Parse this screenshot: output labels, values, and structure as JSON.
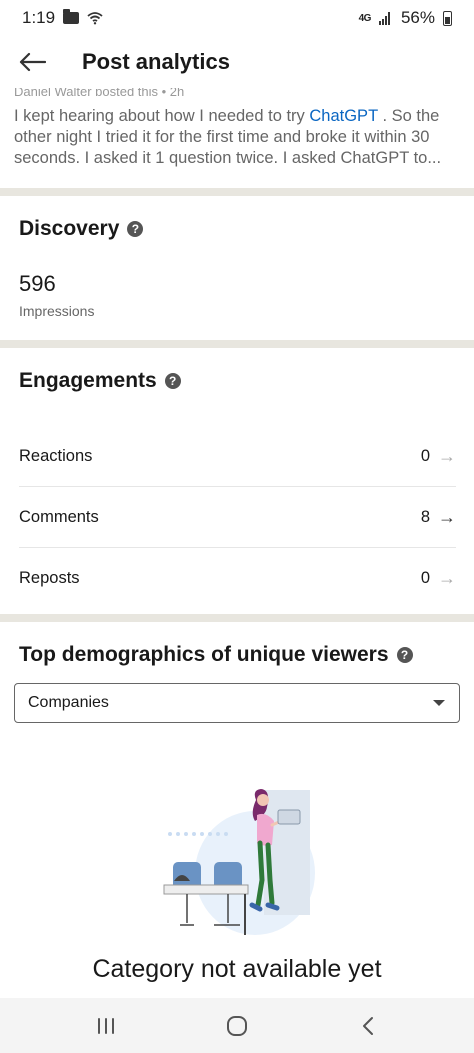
{
  "status_bar": {
    "time": "1:19",
    "network": "4G",
    "battery": "56%"
  },
  "header": {
    "title": "Post analytics"
  },
  "post": {
    "author_line": "Daniel Walter posted this • 2h",
    "text_before": "I kept hearing about how I needed to try ",
    "link_text": "ChatGPT",
    "text_after": " . So the other night I tried it for the first time and broke it within 30 seconds. I asked it 1 question twice. I asked ChatGPT to..."
  },
  "discovery": {
    "title": "Discovery",
    "impressions_value": "596",
    "impressions_label": "Impressions"
  },
  "engagements": {
    "title": "Engagements",
    "rows": [
      {
        "label": "Reactions",
        "value": "0"
      },
      {
        "label": "Comments",
        "value": "8"
      },
      {
        "label": "Reposts",
        "value": "0"
      }
    ]
  },
  "demographics": {
    "title": "Top demographics of unique viewers",
    "selected": "Companies",
    "empty_message": "Category not available yet"
  },
  "icons": [
    "back-arrow-icon",
    "help-icon",
    "right-arrow-icon",
    "chevron-down-icon",
    "recents-icon",
    "home-icon",
    "back-icon"
  ]
}
